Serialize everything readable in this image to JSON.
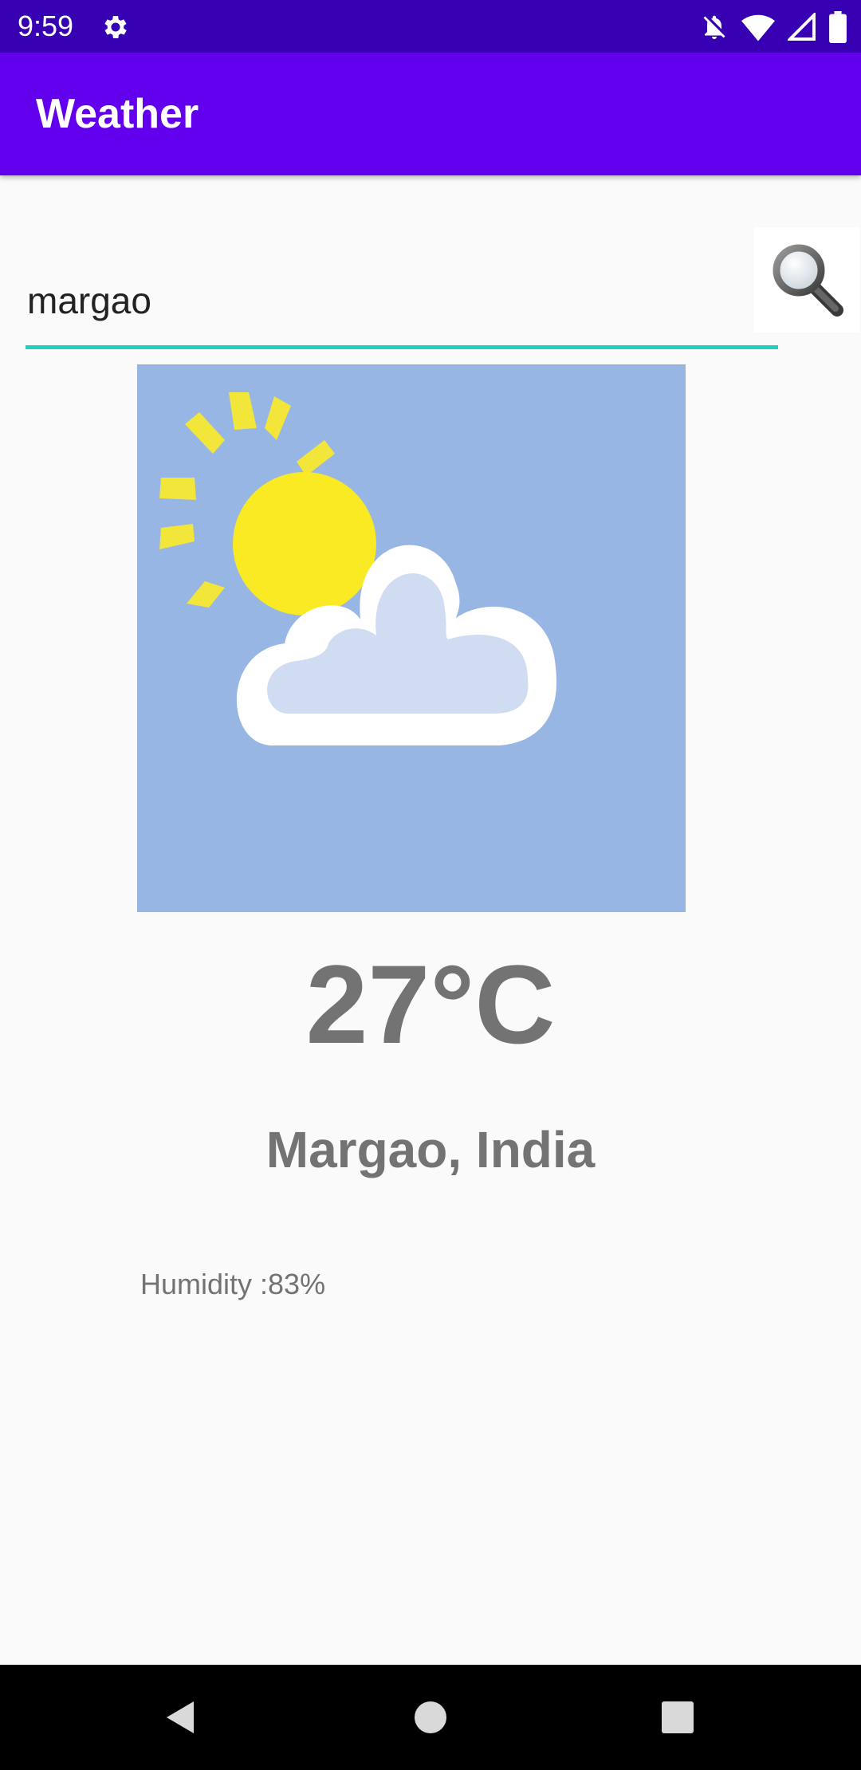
{
  "status_bar": {
    "time": "9:59",
    "icons": [
      "gear-icon",
      "notifications-off-icon",
      "wifi-icon",
      "signal-icon",
      "battery-icon"
    ]
  },
  "app_bar": {
    "title": "Weather"
  },
  "search": {
    "value": "margao",
    "placeholder": "",
    "button_icon": "search-icon",
    "underline_color": "#1fcfc0"
  },
  "weather": {
    "condition_icon": "partly-cloudy-icon",
    "temperature": "27°C",
    "location": "Margao, India",
    "humidity": "Humidity :83%"
  },
  "nav_bar": {
    "icons": [
      "back-icon",
      "home-icon",
      "recents-icon"
    ]
  },
  "colors": {
    "status_bar": "#3700b3",
    "app_bar": "#6200ee",
    "image_background": "#98b6e3",
    "text_gray": "#737373"
  }
}
